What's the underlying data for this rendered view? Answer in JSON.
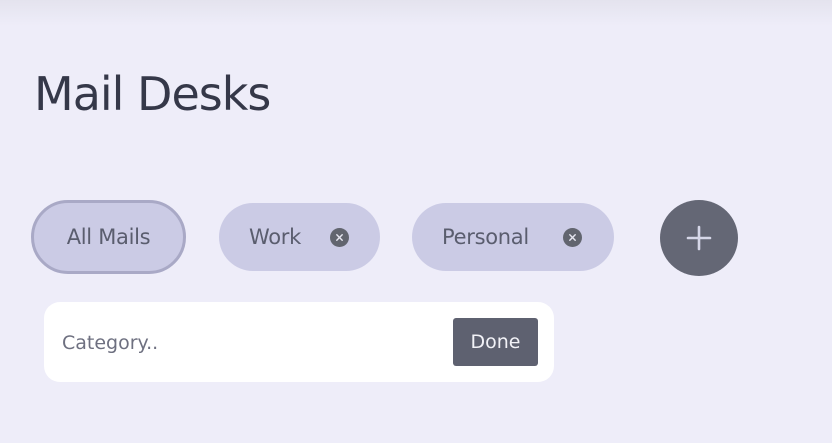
{
  "header": {
    "title": "Mail Desks"
  },
  "categories": [
    {
      "label": "All Mails",
      "selected": true,
      "removable": false
    },
    {
      "label": "Work",
      "selected": false,
      "removable": true,
      "remove_icon": "close-icon"
    },
    {
      "label": "Personal",
      "selected": false,
      "removable": true,
      "remove_icon": "close-icon"
    }
  ],
  "add_category": {
    "icon": "plus-icon"
  },
  "category_form": {
    "input_value": "",
    "input_placeholder": "Category..",
    "done_label": "Done"
  },
  "colors": {
    "background": "#eeedf9",
    "chip": "#cbcbe5",
    "chip_selected_border": "#a9a9c6",
    "add_button": "#646775",
    "done_button": "#5e6170",
    "title_text": "#353849"
  }
}
